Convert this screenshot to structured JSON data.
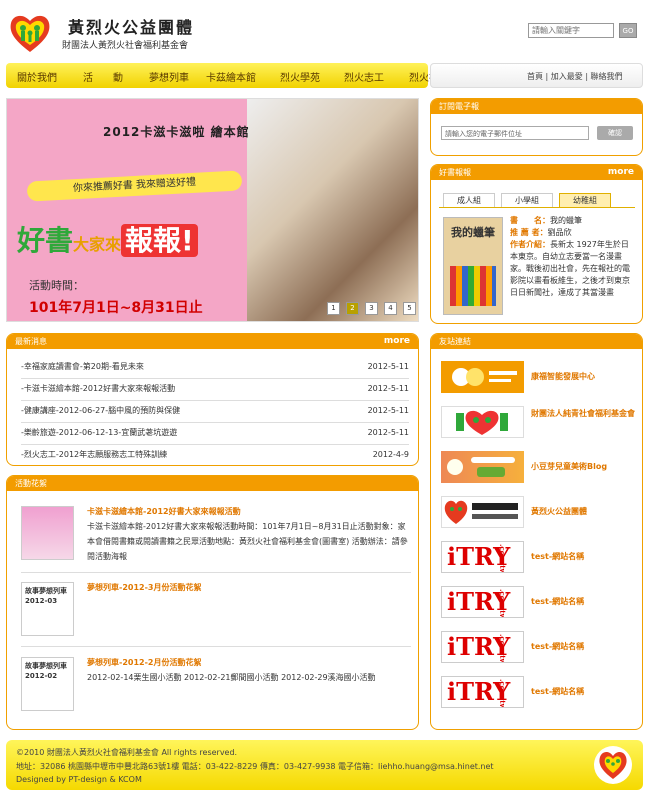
{
  "header": {
    "title": "黃烈火公益團體",
    "subtitle": "財團法人黃烈火社會福利基金會",
    "search_placeholder": "請輸入關鍵字",
    "search_button": "GO"
  },
  "nav": {
    "items": [
      "關於我們",
      "活　　動",
      "夢想列車",
      "卡茲繪本館",
      "烈火學苑",
      "烈火志工",
      "烈火社團"
    ],
    "top_links": "首頁 | 加入最愛 | 聯絡我們"
  },
  "banner": {
    "title": "2012卡滋卡滋啦 繪本館",
    "slogan": "你來推薦好書 我來贈送好禮",
    "big_left": "好書",
    "big_mid": "大家來",
    "big_right": "報報!",
    "time_label": "活動時間：",
    "date": "101年7月1日~8月31日止",
    "pages": [
      "1",
      "2",
      "3",
      "4",
      "5"
    ],
    "active_page": "2"
  },
  "news": {
    "heading": "最新消息",
    "more": "more",
    "items": [
      {
        "title": "-幸福家庭讀書會-第20期-看見未來",
        "date": "2012-5-11"
      },
      {
        "title": "-卡滋卡滋繪本館-2012好書大家來報報活動",
        "date": "2012-5-11"
      },
      {
        "title": "-健康講座-2012-06-27-腦中風的預防與保健",
        "date": "2012-5-11"
      },
      {
        "title": "-樂齡旅遊-2012-06-12-13-宜蘭武荖坑遊遊",
        "date": "2012-5-11"
      },
      {
        "title": "-烈火志工-2012年志願服務志工特殊訓練",
        "date": "2012-4-9"
      }
    ]
  },
  "events": {
    "heading": "活動花絮",
    "items": [
      {
        "title": "卡滋卡滋繪本館-2012好書大家來報報活動",
        "body": "卡滋卡滋繪本館-2012好書大家來報報活動時間：101年7月1日~8月31日止活動對象：家本會借閱書籍或閱讀書籍之民眾活動地點：黃烈火社會福利基金會(圖書室) 活動辦法：請參閱活動海報",
        "thumb_text": ""
      },
      {
        "title": "夢想列車-2012-3月份活動花絮",
        "body": "",
        "thumb_text": "故事夢想列車\n2012-03"
      },
      {
        "title": "夢想列車-2012-2月份活動花絮",
        "body": "2012-02-14栗生國小活動 2012-02-21郵間國小活動 2012-02-29溪海國小活動",
        "thumb_text": "故事夢想列車\n2012-02"
      }
    ]
  },
  "subscribe": {
    "heading": "訂閱電子報",
    "placeholder": "請輸入您的電子郵件位址",
    "button": "確認"
  },
  "books": {
    "heading": "好書報報",
    "more": "more",
    "tabs": [
      "成人組",
      "小學組",
      "幼稚組"
    ],
    "active_tab": "幼稚組",
    "cover_title": "我的蠟筆",
    "title_label": "書　　名：",
    "title_value": "我的蠟筆",
    "author_label": "推 薦 者：",
    "author_value": "劉品欣",
    "intro_label": "作者介紹：",
    "intro_value": "長新太 1927年生於日本東京。自幼立志要當一名漫畫家。戰後初出社會，先在報社的電影院以畫看板維生，之後才到東京日日新聞社，達成了其當漫畫"
  },
  "links": {
    "heading": "友站連結",
    "items": [
      {
        "name": "康福智能發展中心",
        "logo": "kangfu"
      },
      {
        "name": "財團法人純青社會福利基金會",
        "logo": "chunqing"
      },
      {
        "name": "小豆芽兒童美術Blog",
        "logo": "blog"
      },
      {
        "name": "黃烈火公益團體",
        "logo": "self"
      },
      {
        "name": "test-網站名稱",
        "logo": "itry"
      },
      {
        "name": "test-網站名稱",
        "logo": "itry"
      },
      {
        "name": "test-網站名稱",
        "logo": "itry"
      },
      {
        "name": "test-網站名稱",
        "logo": "itry"
      }
    ],
    "itry_text": "iTRY",
    "itry_small": ".com.tw"
  },
  "footer": {
    "line1": "©2010 財團法人黃烈火社會福利基金會 All rights reserved.",
    "line2": "地址：32086 桃園縣中壢市中豐北路63號1樓 電話：03-422-8229 傳真：03-427-9938 電子信箱：liehho.huang@msa.hinet.net",
    "line3": "Designed by PT-design & KCOM"
  },
  "colors": {
    "orange": "#f39c00",
    "yellow": "#f5d900",
    "pink": "#f4a6c6",
    "green": "#2fa83a"
  }
}
